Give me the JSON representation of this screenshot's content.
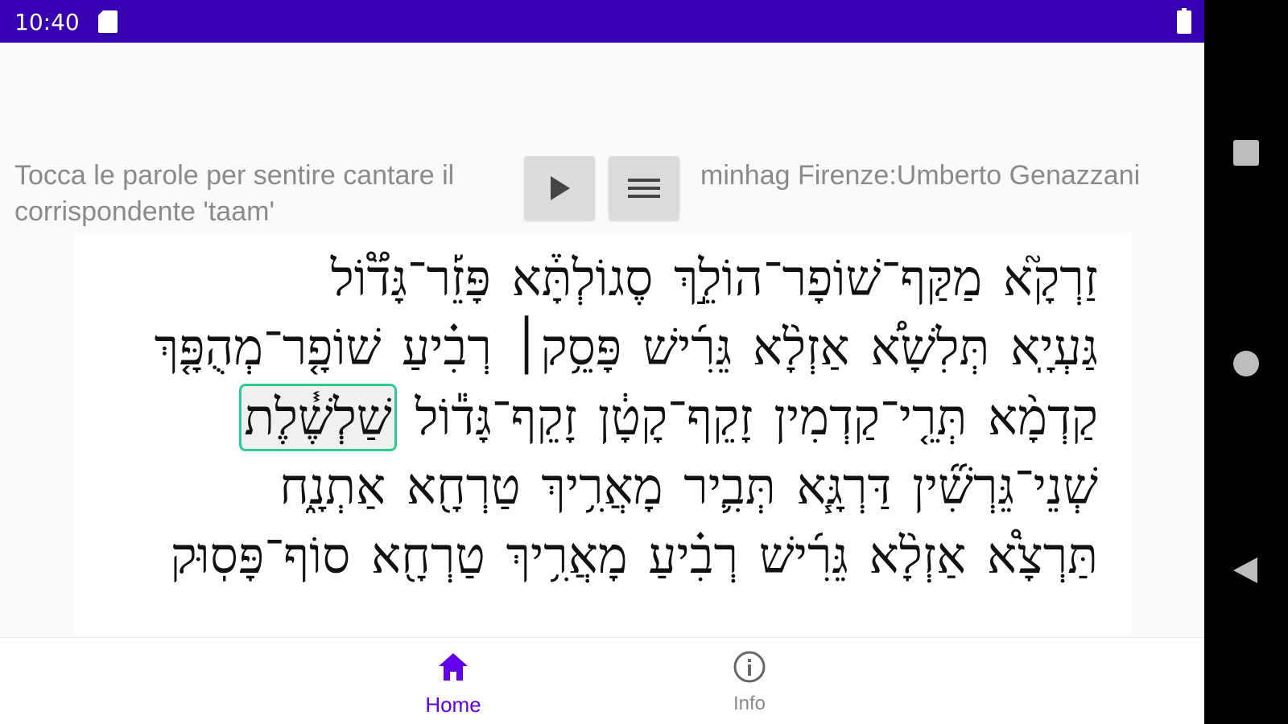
{
  "status_bar": {
    "time": "10:40",
    "sd_icon": "sd-card-icon",
    "battery_icon": "battery-icon"
  },
  "controls": {
    "instruction": "Tocca le parole per sentire cantare il corrispondente 'taam'",
    "play_icon": "play-icon",
    "menu_icon": "menu-icon",
    "minhag": "minhag Firenze:Umberto Genazzani"
  },
  "hebrew_text": {
    "lines": [
      [
        "זַרְקָ֮א",
        "מַקַּף־שׁוֹפָר־הוֹלֵ֣ךְ",
        "סֶגוֹלְתָּ֒א",
        "פָּזֵ֡ר־גָּד֟וֹל"
      ],
      [
        "גַּעְיָֽא",
        "תְּלִשָׁא֠",
        "אַזְלָ֨א",
        "גֵּרִ֜ישׁ",
        "פָּסֵ֥ק׀",
        "רְבִ֗יעַ",
        "שׁוֹפָ֤ר־מְהֻפָּ֤ךְ"
      ],
      [
        "קַדְמָ֨א",
        "תְּרֵ֤י־קַדְמִין",
        "זָקֵף־קָטָ֔ן",
        "זָקֵף־גָּד֕וֹל",
        "שַׁלְשֶׁ֓לֶת"
      ],
      [
        "שְׁנֵי־גֵּרְשִׁ֞ין",
        "דַּרְגָּ֧א",
        "תְּבִ֛יר",
        "מָאֲרִ֥יךְ",
        "טַרְחָ֖א",
        "אַתְנָ֑ח"
      ],
      [
        "תַּרְצָ֩א",
        "אַזְלָ֨א",
        "גֵּרִ֜ישׁ",
        "רְבִ֗יעַ",
        "מָאֲרִ֥יךְ",
        "טַרְחָ֖א",
        "סוֹף־פָּסֽוּק"
      ]
    ],
    "selected_word": "שַׁלְשֶׁ֓לֶת"
  },
  "bottom_nav": {
    "home_label": "Home",
    "home_icon": "home-icon",
    "info_label": "Info",
    "info_icon": "info-icon"
  },
  "system_nav": {
    "recents_icon": "recents-icon",
    "home_icon": "circle-home-icon",
    "back_icon": "back-triangle-icon"
  },
  "colors": {
    "status_bar": "#3700b3",
    "accent": "#6200ee",
    "selection_border": "#2ecc8f",
    "secondary_text": "#8a8a8a"
  }
}
